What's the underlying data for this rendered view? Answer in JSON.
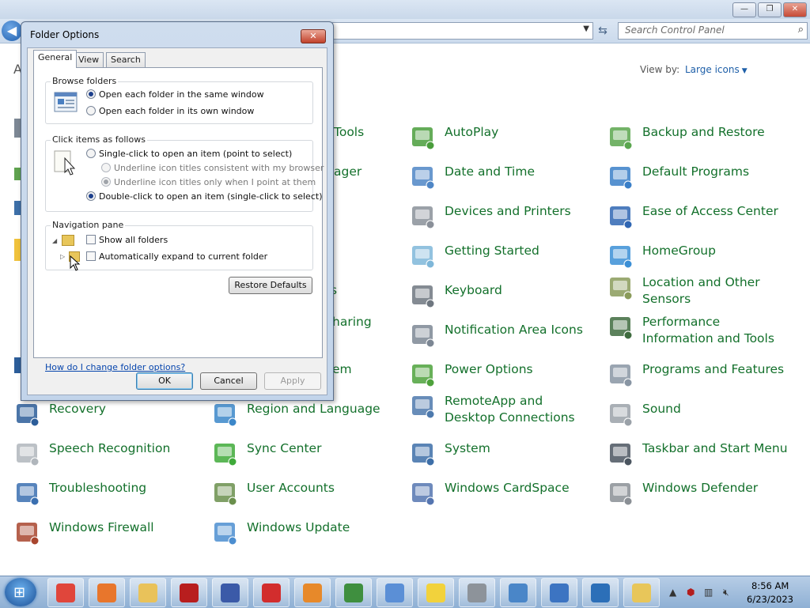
{
  "window": {
    "search_placeholder": "Search Control Panel",
    "view_by_label": "View by:",
    "view_by_value": "Large icons",
    "partial_heading": "A"
  },
  "control_panel": {
    "col1_partial": [
      {
        "label": "Tools"
      },
      {
        "label": "ager"
      },
      {
        "label": "s"
      },
      {
        "label": "haring"
      },
      {
        "label": "em"
      }
    ],
    "items": [
      {
        "label": "AutoPlay",
        "icon": "autoplay-icon"
      },
      {
        "label": "Backup and Restore",
        "icon": "backup-icon"
      },
      {
        "label": "Date and Time",
        "icon": "calendar-clock-icon"
      },
      {
        "label": "Default Programs",
        "icon": "default-programs-icon"
      },
      {
        "label": "Devices and Printers",
        "icon": "printer-icon"
      },
      {
        "label": "Ease of Access Center",
        "icon": "ease-of-access-icon"
      },
      {
        "label": "Getting Started",
        "icon": "getting-started-icon"
      },
      {
        "label": "HomeGroup",
        "icon": "homegroup-icon"
      },
      {
        "label": "Keyboard",
        "icon": "keyboard-icon"
      },
      {
        "label": "Location and Other Sensors",
        "icon": "location-sensor-icon"
      },
      {
        "label": "Notification Area Icons",
        "icon": "notification-area-icon"
      },
      {
        "label": "Performance Information and Tools",
        "icon": "performance-icon"
      },
      {
        "label": "Power Options",
        "icon": "battery-icon"
      },
      {
        "label": "Programs and Features",
        "icon": "programs-icon"
      },
      {
        "label": "Recovery",
        "icon": "recovery-icon"
      },
      {
        "label": "Region and Language",
        "icon": "globe-icon"
      },
      {
        "label": "RemoteApp and Desktop Connections",
        "icon": "remoteapp-icon"
      },
      {
        "label": "Sound",
        "icon": "speaker-icon"
      },
      {
        "label": "Speech Recognition",
        "icon": "microphone-icon"
      },
      {
        "label": "Sync Center",
        "icon": "sync-icon"
      },
      {
        "label": "System",
        "icon": "system-icon"
      },
      {
        "label": "Taskbar and Start Menu",
        "icon": "taskbar-icon"
      },
      {
        "label": "Troubleshooting",
        "icon": "troubleshoot-icon"
      },
      {
        "label": "User Accounts",
        "icon": "users-icon"
      },
      {
        "label": "Windows CardSpace",
        "icon": "cardspace-icon"
      },
      {
        "label": "Windows Defender",
        "icon": "defender-icon"
      },
      {
        "label": "Windows Firewall",
        "icon": "firewall-icon"
      },
      {
        "label": "Windows Update",
        "icon": "windows-update-icon"
      }
    ]
  },
  "dialog": {
    "title": "Folder Options",
    "tabs": [
      "General",
      "View",
      "Search"
    ],
    "browse_folders": {
      "title": "Browse folders",
      "options": [
        "Open each folder in the same window",
        "Open each folder in its own window"
      ],
      "selected": 0
    },
    "click_items": {
      "title": "Click items as follows",
      "single_click": "Single-click to open an item (point to select)",
      "underline_browser": "Underline icon titles consistent with my browser",
      "underline_point": "Underline icon titles only when I point at them",
      "double_click": "Double-click to open an item (single-click to select)"
    },
    "navigation_pane": {
      "title": "Navigation pane",
      "show_all_folders": "Show all folders",
      "auto_expand": "Automatically expand to current folder"
    },
    "restore_defaults": "Restore Defaults",
    "help_link": "How do I change folder options?",
    "ok": "OK",
    "cancel": "Cancel",
    "apply": "Apply"
  },
  "taskbar": {
    "time": "8:56 AM",
    "date": "6/23/2023",
    "apps": [
      "chrome-icon",
      "firefox-icon",
      "explorer-icon",
      "redapp-icon",
      "remote-icon",
      "recorder-icon",
      "search-tool-icon",
      "chart-app-icon",
      "plane-icon",
      "pdf-icon",
      "printer-icon",
      "network-icon",
      "monitor-icon",
      "display-icon",
      "folder-options-icon"
    ]
  }
}
